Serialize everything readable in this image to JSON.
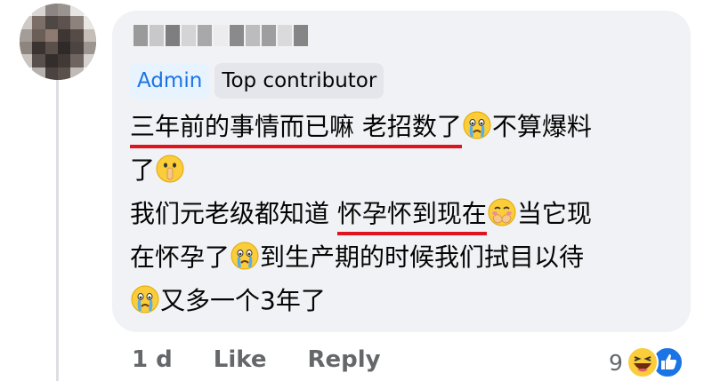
{
  "comment": {
    "badges": {
      "admin": "Admin",
      "top_contributor": "Top contributor"
    },
    "lines": [
      {
        "seg1": "三年前的事情而已嘛 老招数了",
        "seg2": "不算爆料"
      },
      {
        "seg1": "了"
      },
      {
        "seg1": "我们元老级都知道 ",
        "seg2": "怀孕怀到现在",
        "seg3": "当它现"
      },
      {
        "seg1": "在怀孕了",
        "seg2": "到生产期的时候我们拭目以待"
      },
      {
        "seg1": "又多一个3年了"
      }
    ],
    "emojis": [
      "crying-face",
      "shushing-face",
      "hand-over-mouth-face",
      "crying-face",
      "crying-face"
    ]
  },
  "actions": {
    "time": "1 d",
    "like": "Like",
    "reply": "Reply"
  },
  "reactions": {
    "count": "9",
    "types": [
      "haha",
      "like"
    ]
  },
  "colors": {
    "bubble": "#f0f2f5",
    "admin_text": "#1b74e4",
    "underline": "#e0141e",
    "meta_text": "#65676b"
  }
}
